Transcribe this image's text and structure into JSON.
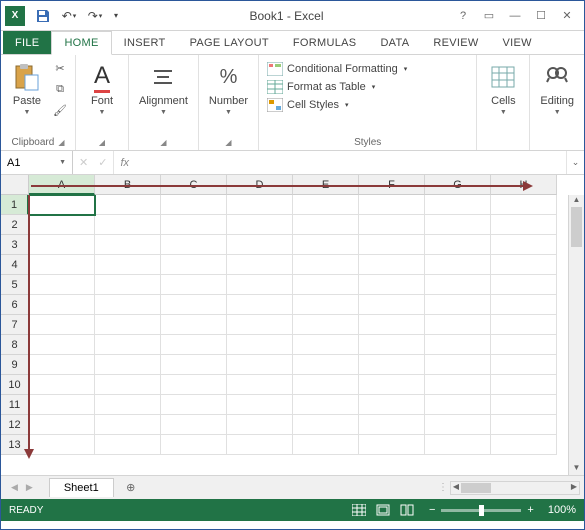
{
  "titlebar": {
    "title": "Book1 - Excel"
  },
  "tabs": {
    "file": "FILE",
    "items": [
      "HOME",
      "INSERT",
      "PAGE LAYOUT",
      "FORMULAS",
      "DATA",
      "REVIEW",
      "VIEW"
    ],
    "active": "HOME"
  },
  "ribbon": {
    "clipboard": {
      "label": "Clipboard",
      "paste": "Paste"
    },
    "font": {
      "label": "Font",
      "btn": "Font"
    },
    "alignment": {
      "label": "",
      "btn": "Alignment"
    },
    "number": {
      "label": "",
      "btn": "Number",
      "symbol": "%"
    },
    "styles": {
      "label": "Styles",
      "cond": "Conditional Formatting",
      "table": "Format as Table",
      "cell": "Cell Styles"
    },
    "cells": {
      "btn": "Cells"
    },
    "editing": {
      "btn": "Editing"
    }
  },
  "namebox": {
    "value": "A1"
  },
  "formula": {
    "fx": "fx",
    "value": ""
  },
  "grid": {
    "columns": [
      "A",
      "B",
      "C",
      "D",
      "E",
      "F",
      "G",
      "H"
    ],
    "rows": [
      "1",
      "2",
      "3",
      "4",
      "5",
      "6",
      "7",
      "8",
      "9",
      "10",
      "11",
      "12",
      "13"
    ],
    "active_cell": "A1"
  },
  "sheets": {
    "active": "Sheet1"
  },
  "status": {
    "ready": "READY",
    "zoom": "100%"
  }
}
